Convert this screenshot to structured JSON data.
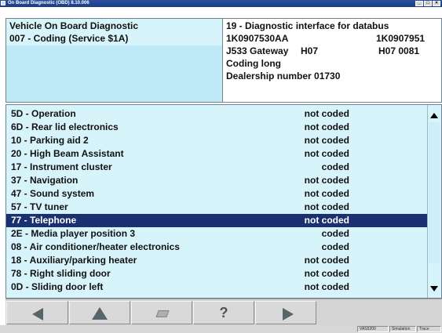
{
  "window": {
    "title": "On Board Diagnostic (OBD) 8.10.006"
  },
  "header_left": {
    "line1": "Vehicle On Board Diagnostic",
    "line2": "007 - Coding (Service $1A)"
  },
  "header_right": {
    "line1": "19 - Diagnostic interface for databus",
    "part_number": "1K0907530AA",
    "part_number_right": "1K0907951",
    "component": "J533 Gateway",
    "component_version": "H07",
    "version_right": "H07 0081",
    "coding": "Coding long",
    "dealership": "Dealership number 01730"
  },
  "modules": [
    {
      "name": "5D - Operation",
      "status": "not coded"
    },
    {
      "name": "6D - Rear lid electronics",
      "status": "not coded"
    },
    {
      "name": "10 - Parking aid 2",
      "status": "not coded"
    },
    {
      "name": "20 - High Beam Assistant",
      "status": "not coded"
    },
    {
      "name": "17 - Instrument cluster",
      "status": "coded"
    },
    {
      "name": "37 - Navigation",
      "status": "not coded"
    },
    {
      "name": "47 - Sound system",
      "status": "not coded"
    },
    {
      "name": "57 - TV tuner",
      "status": "not coded"
    },
    {
      "name": "77 - Telephone",
      "status": "not coded",
      "selected": true
    },
    {
      "name": "2E - Media player position 3",
      "status": "coded"
    },
    {
      "name": "08 - Air conditioner/heater electronics",
      "status": "coded"
    },
    {
      "name": "18 - Auxiliary/parking heater",
      "status": "not coded"
    },
    {
      "name": "78 - Right sliding door",
      "status": "not coded"
    },
    {
      "name": "0D - Sliding door left",
      "status": "not coded"
    }
  ],
  "toolbar": {
    "buttons": [
      {
        "name": "back-button",
        "icon": "arrow-left-icon"
      },
      {
        "name": "up-button",
        "icon": "arrow-up-icon"
      },
      {
        "name": "print-button",
        "icon": "printer-icon"
      },
      {
        "name": "help-button",
        "icon": "question-icon",
        "glyph": "?"
      },
      {
        "name": "forward-button",
        "icon": "arrow-right-icon"
      }
    ]
  },
  "statusbar": {
    "items": [
      "VAS5200",
      "Simulation",
      "Trace"
    ]
  }
}
